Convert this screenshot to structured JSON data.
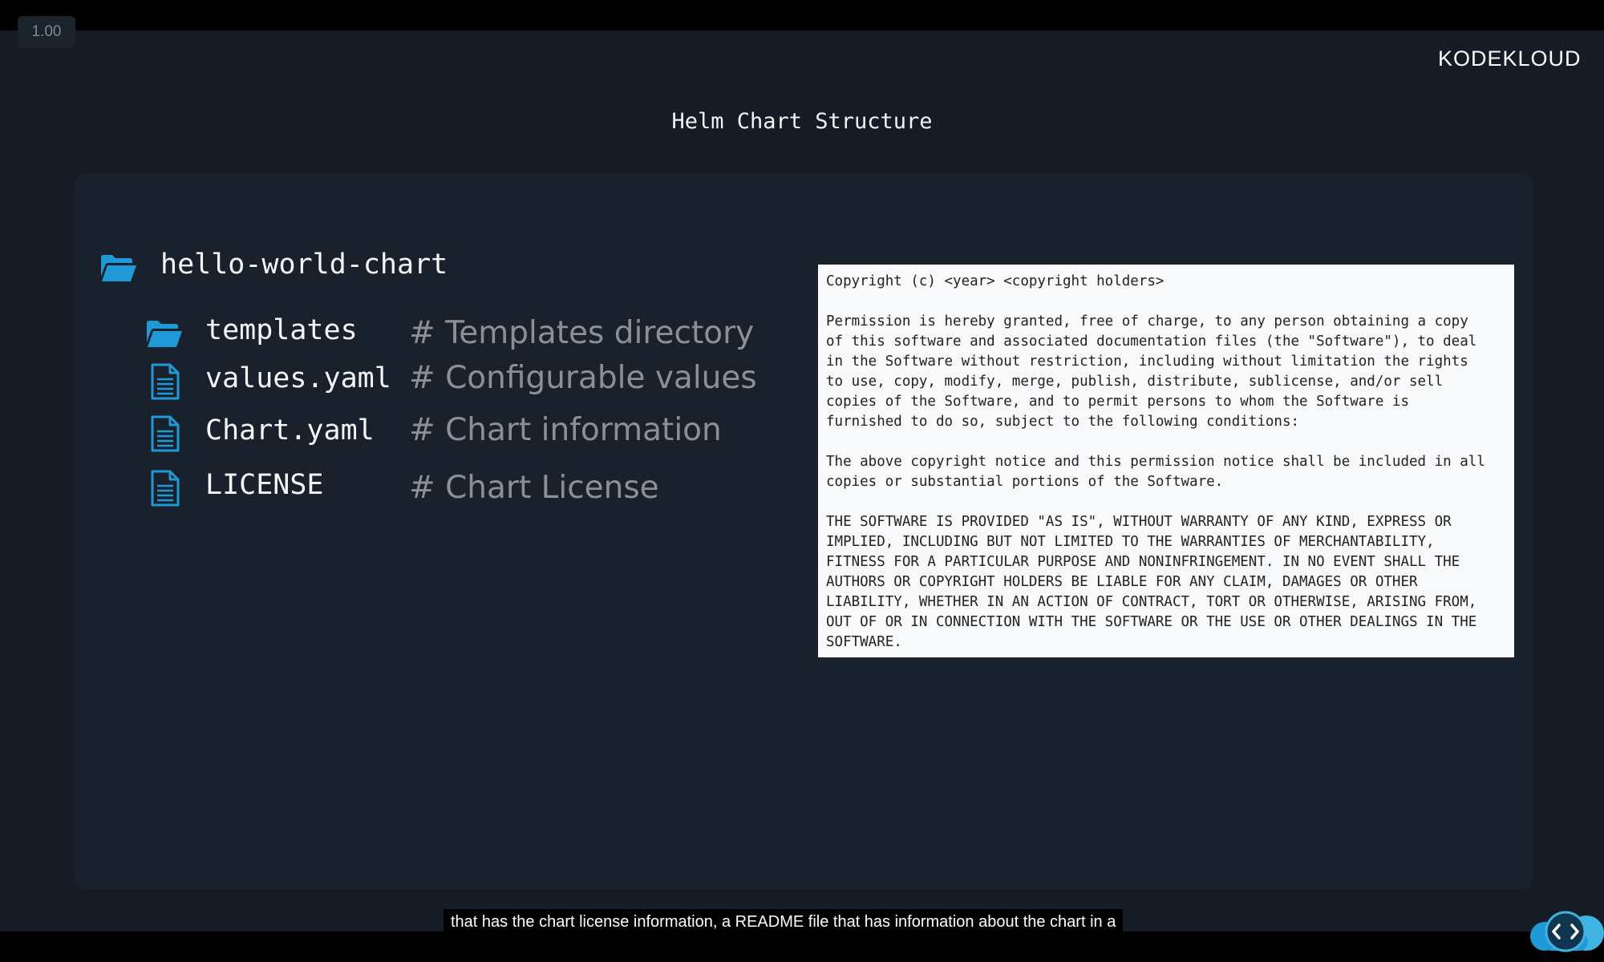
{
  "player": {
    "speed": "1.00",
    "caption": "that has the chart license information, a README file that has information about the chart in a",
    "brand": "KODEKLOUD"
  },
  "slide": {
    "title": "Helm Chart Structure",
    "root": {
      "name": "hello-world-chart",
      "icon": "folder-open-icon"
    },
    "files": [
      {
        "name": "templates",
        "comment": "# Templates directory",
        "icon": "folder-open-icon"
      },
      {
        "name": "values.yaml",
        "comment": "# Configurable values",
        "icon": "document-icon"
      },
      {
        "name": "Chart.yaml",
        "comment": "# Chart information",
        "icon": "document-icon"
      },
      {
        "name": "LICENSE",
        "comment": "# Chart License",
        "icon": "document-icon"
      }
    ],
    "license_text": [
      "Copyright (c) <year> <copyright holders>",
      "Permission is hereby granted, free of charge, to any person obtaining a copy\nof this software and associated documentation files (the \"Software\"), to deal\nin the Software without restriction, including without limitation the rights\nto use, copy, modify, merge, publish, distribute, sublicense, and/or sell\ncopies of the Software, and to permit persons to whom the Software is\nfurnished to do so, subject to the following conditions:",
      "The above copyright notice and this permission notice shall be included in all\ncopies or substantial portions of the Software.",
      "THE SOFTWARE IS PROVIDED \"AS IS\", WITHOUT WARRANTY OF ANY KIND, EXPRESS OR\nIMPLIED, INCLUDING BUT NOT LIMITED TO THE WARRANTIES OF MERCHANTABILITY,\nFITNESS FOR A PARTICULAR PURPOSE AND NONINFRINGEMENT. IN NO EVENT SHALL THE\nAUTHORS OR COPYRIGHT HOLDERS BE LIABLE FOR ANY CLAIM, DAMAGES OR OTHER\nLIABILITY, WHETHER IN AN ACTION OF CONTRACT, TORT OR OTHERWISE, ARISING FROM,\nOUT OF OR IN CONNECTION WITH THE SOFTWARE OR THE USE OR OTHER DEALINGS IN THE\nSOFTWARE."
    ]
  },
  "colors": {
    "icon_blue": "#1f9ad6",
    "background": "#151c25",
    "panel": "#18212c",
    "comment_gray": "#8b9097"
  }
}
